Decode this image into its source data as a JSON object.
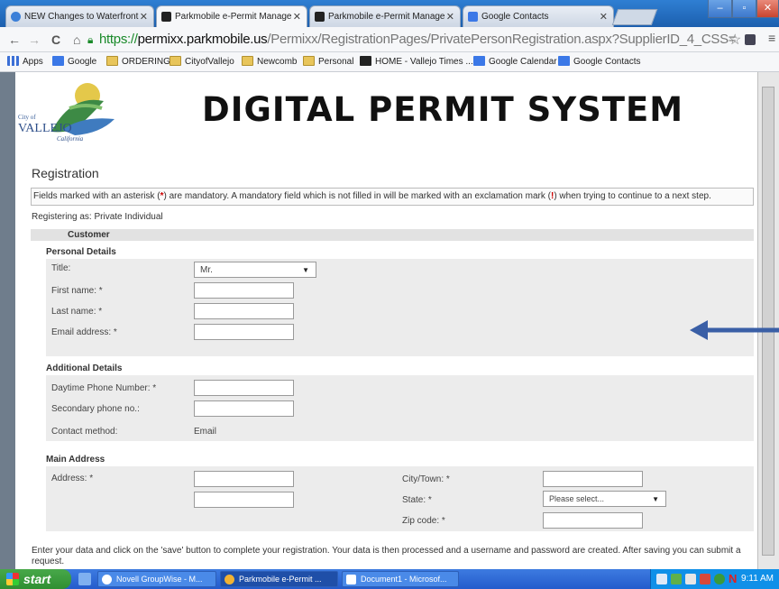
{
  "browser": {
    "tabs": [
      {
        "title": "NEW Changes to Waterfront",
        "icon": "web-icon",
        "active": false
      },
      {
        "title": "Parkmobile e-Permit Manage",
        "icon": "parkmobile-icon",
        "active": true
      },
      {
        "title": "Parkmobile e-Permit Manage",
        "icon": "parkmobile-icon",
        "active": false
      },
      {
        "title": "Google Contacts",
        "icon": "google-contacts-icon",
        "active": false
      }
    ],
    "url": {
      "scheme": "https://",
      "host": "permixx.parkmobile.us",
      "path": "/Permixx/RegistrationPages/PrivatePersonRegistration.aspx?SupplierID_4_CSS="
    },
    "bookmarks": [
      {
        "label": "Apps",
        "icon": "apps-icon"
      },
      {
        "label": "Google",
        "icon": "google-icon"
      },
      {
        "label": "ORDERING",
        "icon": "folder-icon"
      },
      {
        "label": "CityofVallejo",
        "icon": "folder-icon"
      },
      {
        "label": "Newcomb",
        "icon": "folder-icon"
      },
      {
        "label": "Personal",
        "icon": "folder-icon"
      },
      {
        "label": "HOME - Vallejo Times ...",
        "icon": "times-herald-icon"
      },
      {
        "label": "Google Calendar",
        "icon": "google-calendar-icon"
      },
      {
        "label": "Google Contacts",
        "icon": "google-contacts-icon"
      }
    ]
  },
  "page": {
    "logo": {
      "city_of": "City of",
      "name": "VALLEJO",
      "state": "California"
    },
    "banner": "DIGITAL PERMIT SYSTEM",
    "heading": "Registration",
    "info_pre": "Fields marked with an asterisk (",
    "info_star": "*",
    "info_mid": ") are mandatory. A mandatory field which is not filled in will be marked with an exclamation mark (",
    "info_bang": "!",
    "info_post": ") when trying to continue to a next step.",
    "registering_as": "Registering as: Private Individual",
    "customer_bar": "Customer",
    "personal": {
      "heading": "Personal Details",
      "title_label": "Title:",
      "title_value": "Mr.",
      "first_name_label": "First name: *",
      "last_name_label": "Last name: *",
      "email_label": "Email address: *"
    },
    "additional": {
      "heading": "Additional Details",
      "daytime_phone_label": "Daytime Phone Number: *",
      "secondary_phone_label": "Secondary phone no.:",
      "contact_method_label": "Contact method:",
      "contact_method_value": "Email"
    },
    "address": {
      "heading": "Main Address",
      "address_label": "Address: *",
      "city_label": "City/Town: *",
      "state_label": "State: *",
      "state_value": "Please select...",
      "zip_label": "Zip code: *"
    },
    "footer": "Enter your data and click on the 'save' button to complete your registration. Your data is then processed and a username and password are created. After saving you can submit a request."
  },
  "taskbar": {
    "start": "start",
    "tasks": [
      {
        "label": "Novell GroupWise - M...",
        "icon": "groupwise-icon"
      },
      {
        "label": "Parkmobile e-Permit ...",
        "icon": "chrome-icon"
      },
      {
        "label": "Document1 - Microsof...",
        "icon": "word-icon"
      }
    ],
    "clock": "9:11 AM"
  },
  "colors": {
    "titlebar": "#2f7fd3",
    "arrow": "#3a5fa6",
    "secure": "#1a8a2a",
    "bang": "#cc0000"
  }
}
